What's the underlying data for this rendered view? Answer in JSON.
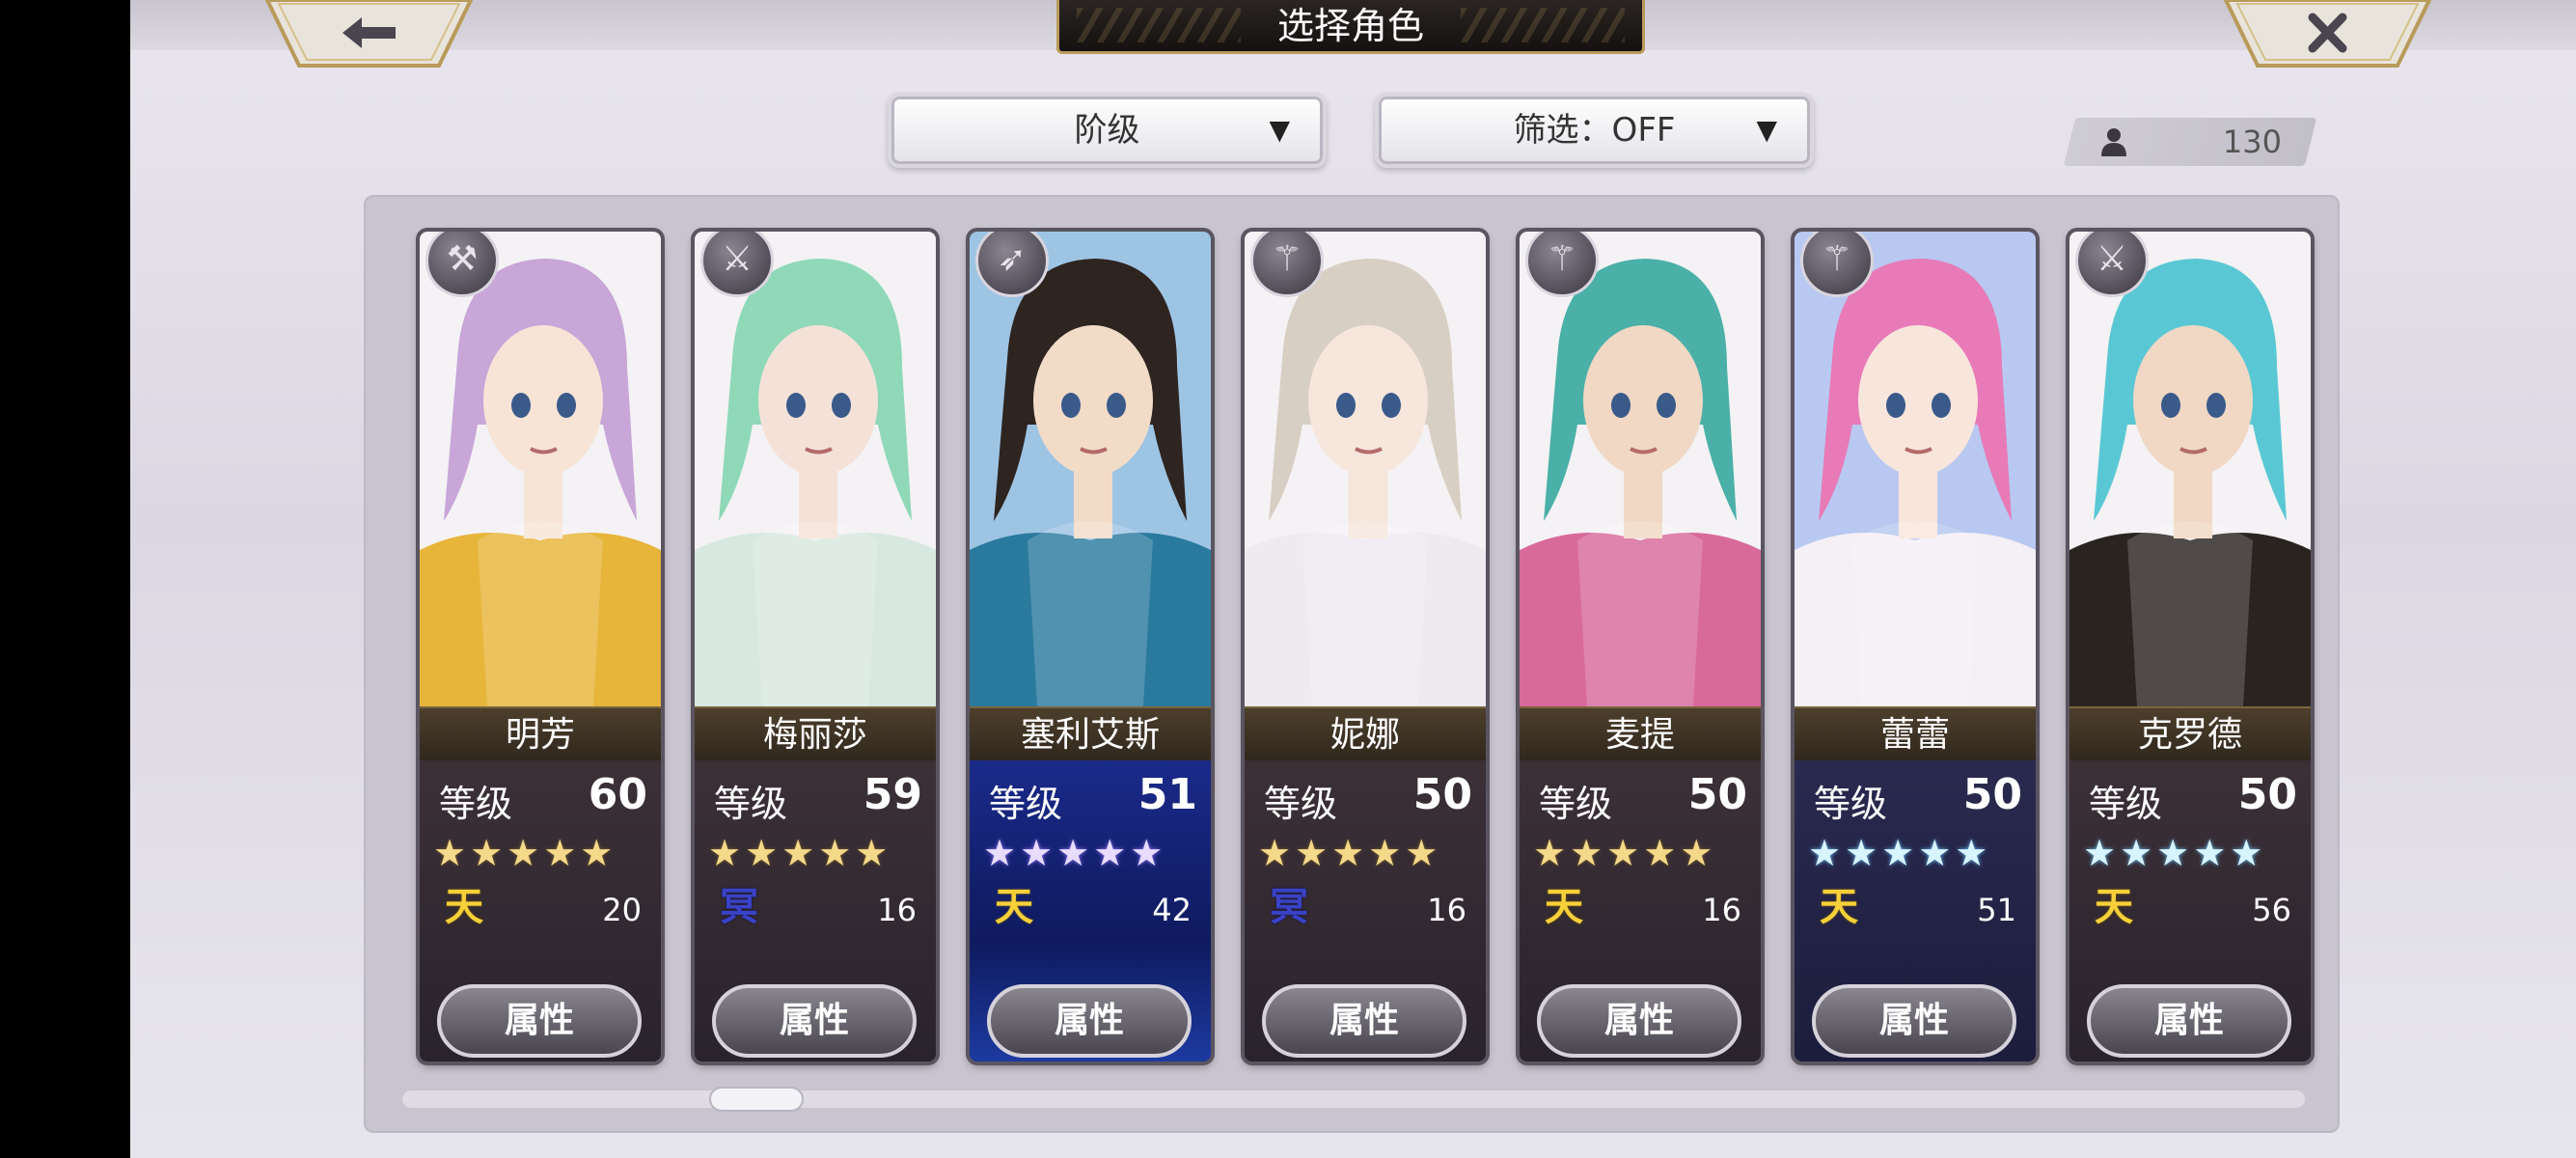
{
  "header": {
    "title": "选择角色",
    "back_icon": "arrow-left-icon",
    "close_icon": "close-icon"
  },
  "filters": {
    "sort_label": "阶级",
    "filter_label": "筛选：OFF"
  },
  "roster": {
    "count": "130",
    "icon": "person-icon"
  },
  "characters": [
    {
      "name": "明芳",
      "level_label": "等级",
      "level": "60",
      "stars": "★★★★★",
      "star_style": "gold",
      "rank": "天",
      "rank_style": "gold",
      "potential": "20",
      "button": "属性",
      "weapon": "hammer-icon",
      "bg": "bronze",
      "hair": "#c8a6d8",
      "outfit": "#e7b53a",
      "skin": "#f7e4d6"
    },
    {
      "name": "梅丽莎",
      "level_label": "等级",
      "level": "59",
      "stars": "★★★★★",
      "star_style": "gold",
      "rank": "冥",
      "rank_style": "navy",
      "potential": "16",
      "button": "属性",
      "weapon": "sword-icon",
      "bg": "bronze",
      "hair": "#8fd8b8",
      "outfit": "#d8e8e0",
      "skin": "#f4e2d8"
    },
    {
      "name": "塞利艾斯",
      "level_label": "等级",
      "level": "51",
      "stars": "★★★★★",
      "star_style": "lilac",
      "rank": "天",
      "rank_style": "gold",
      "potential": "42",
      "button": "属性",
      "weapon": "bow-icon",
      "bg": "blue",
      "hair": "#2e2420",
      "outfit": "#2a7a9e",
      "skin": "#f2dcc8"
    },
    {
      "name": "妮娜",
      "level_label": "等级",
      "level": "50",
      "stars": "★★★★★",
      "star_style": "gold",
      "rank": "冥",
      "rank_style": "navy",
      "potential": "16",
      "button": "属性",
      "weapon": "staff-icon",
      "bg": "bronze",
      "hair": "#d8cfc4",
      "outfit": "#eeeaf0",
      "skin": "#f6e6dc"
    },
    {
      "name": "麦提",
      "level_label": "等级",
      "level": "50",
      "stars": "★★★★★",
      "star_style": "gold",
      "rank": "天",
      "rank_style": "gold",
      "potential": "16",
      "button": "属性",
      "weapon": "staff-icon",
      "bg": "bronze",
      "hair": "#4ab0a8",
      "outfit": "#d86a9a",
      "skin": "#f0d8c4"
    },
    {
      "name": "蕾蕾",
      "level_label": "等级",
      "level": "50",
      "stars": "★★★★★",
      "star_style": "ice",
      "rank": "天",
      "rank_style": "gold",
      "potential": "51",
      "button": "属性",
      "weapon": "staff-icon",
      "bg": "navy",
      "hair": "#e87ab8",
      "outfit": "#f4f0f6",
      "skin": "#f8e6dc"
    },
    {
      "name": "克罗德",
      "level_label": "等级",
      "level": "50",
      "stars": "★★★★★",
      "star_style": "ice",
      "rank": "天",
      "rank_style": "gold",
      "potential": "56",
      "button": "属性",
      "weapon": "sword-icon",
      "bg": "bronze",
      "hair": "#5ac8d4",
      "outfit": "#2a2420",
      "skin": "#f0d8c4"
    }
  ],
  "colors": {
    "accent_gold": "#f7d03a",
    "panel_bg": "#c9c5d0",
    "title_bg": "#141110"
  }
}
